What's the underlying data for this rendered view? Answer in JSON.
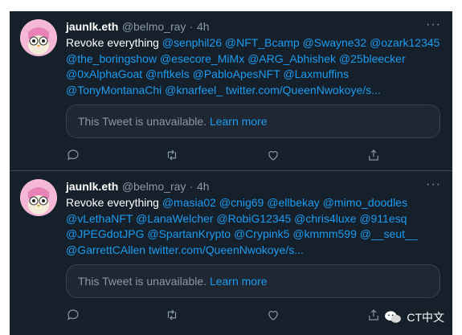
{
  "tweets": [
    {
      "name": "jaunlk.eth",
      "handle": "@belmo_ray",
      "separator": "·",
      "time": "4h",
      "text_prefix": "Revoke everything",
      "mentions": [
        "@senphil26",
        "@NFT_Bcamp",
        "@Swayne32",
        "@ozark12345",
        "@the_boringshow",
        "@esecore_MiMx",
        "@ARG_Abhishek",
        "@25bleecker",
        "@0xAlphaGoat",
        "@nftkels",
        "@PabloApesNFT",
        "@Laxmuffins",
        "@TonyMontanaChi",
        "@knarfeel_"
      ],
      "link": "twitter.com/QueenNwokoye/s...",
      "quote_text": "This Tweet is unavailable.",
      "quote_link": "Learn more"
    },
    {
      "name": "jaunlk.eth",
      "handle": "@belmo_ray",
      "separator": "·",
      "time": "4h",
      "text_prefix": "Revoke everything",
      "mentions": [
        "@masia02",
        "@cnig69",
        "@ellbekay",
        "@mimo_doodles",
        "@vLethaNFT",
        "@LanaWelcher",
        "@RobiG12345",
        "@chris4luxe",
        "@911esq",
        "@JPEGdotJPG",
        "@SpartanKrypto",
        "@Crypink5",
        "@kmmm599",
        "@__seut__",
        "@GarrettCAllen"
      ],
      "link": "twitter.com/QueenNwokoye/s...",
      "quote_text": "This Tweet is unavailable.",
      "quote_link": "Learn more"
    }
  ],
  "more_glyph": "···",
  "watermark": {
    "text": "CT中文"
  },
  "icons": [
    "reply-icon",
    "retweet-icon",
    "like-icon",
    "share-icon",
    "more-icon"
  ],
  "colors": {
    "background": "#15202b",
    "link": "#1d9bf0",
    "muted": "#8b98a5",
    "border": "#38444d"
  }
}
